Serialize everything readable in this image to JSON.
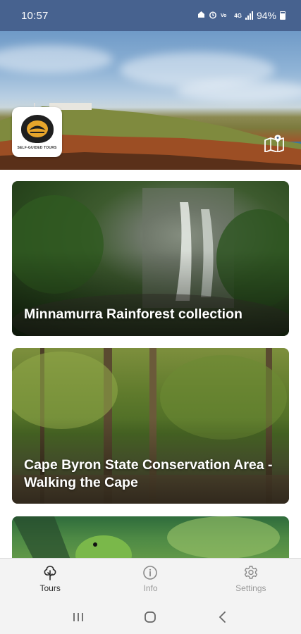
{
  "status_bar": {
    "time": "10:57",
    "battery": "94%",
    "network_label": "4G"
  },
  "hero": {
    "logo_text": "SELF-GUIDED TOURS",
    "map_icon": "map-icon"
  },
  "tours": [
    {
      "title": "Minnamurra Rainforest collection"
    },
    {
      "title": "Cape Byron State Conservation Area - Walking the Cape"
    },
    {
      "title": ""
    }
  ],
  "bottom_nav": {
    "items": [
      {
        "label": "Tours",
        "icon": "tree-icon",
        "active": true
      },
      {
        "label": "Info",
        "icon": "info-icon",
        "active": false
      },
      {
        "label": "Settings",
        "icon": "gear-icon",
        "active": false
      }
    ]
  },
  "colors": {
    "status_bar": "#47628f",
    "nav_background": "#f3f3f3",
    "nav_active": "#2a2a2a",
    "nav_inactive": "#9a9a9a"
  }
}
